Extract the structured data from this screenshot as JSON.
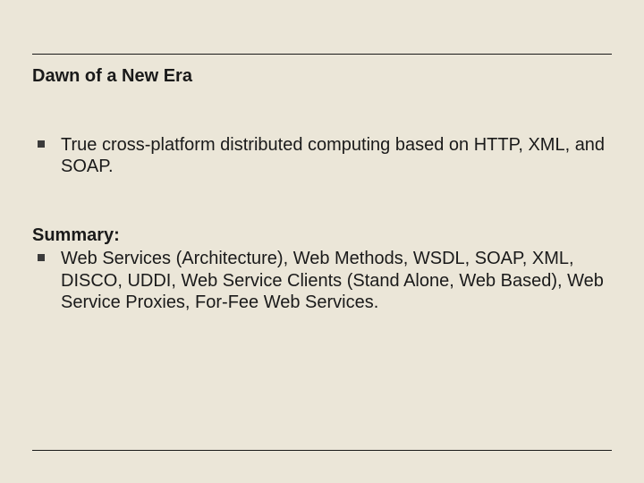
{
  "slide": {
    "title": "Dawn of a New Era",
    "sections": [
      {
        "heading": null,
        "bullets": [
          "True cross-platform distributed computing based on HTTP, XML, and SOAP."
        ]
      },
      {
        "heading": "Summary:",
        "bullets": [
          "Web Services (Architecture), Web Methods, WSDL, SOAP, XML, DISCO, UDDI, Web Service Clients (Stand Alone, Web Based), Web Service Proxies, For-Fee Web Services."
        ]
      }
    ]
  }
}
